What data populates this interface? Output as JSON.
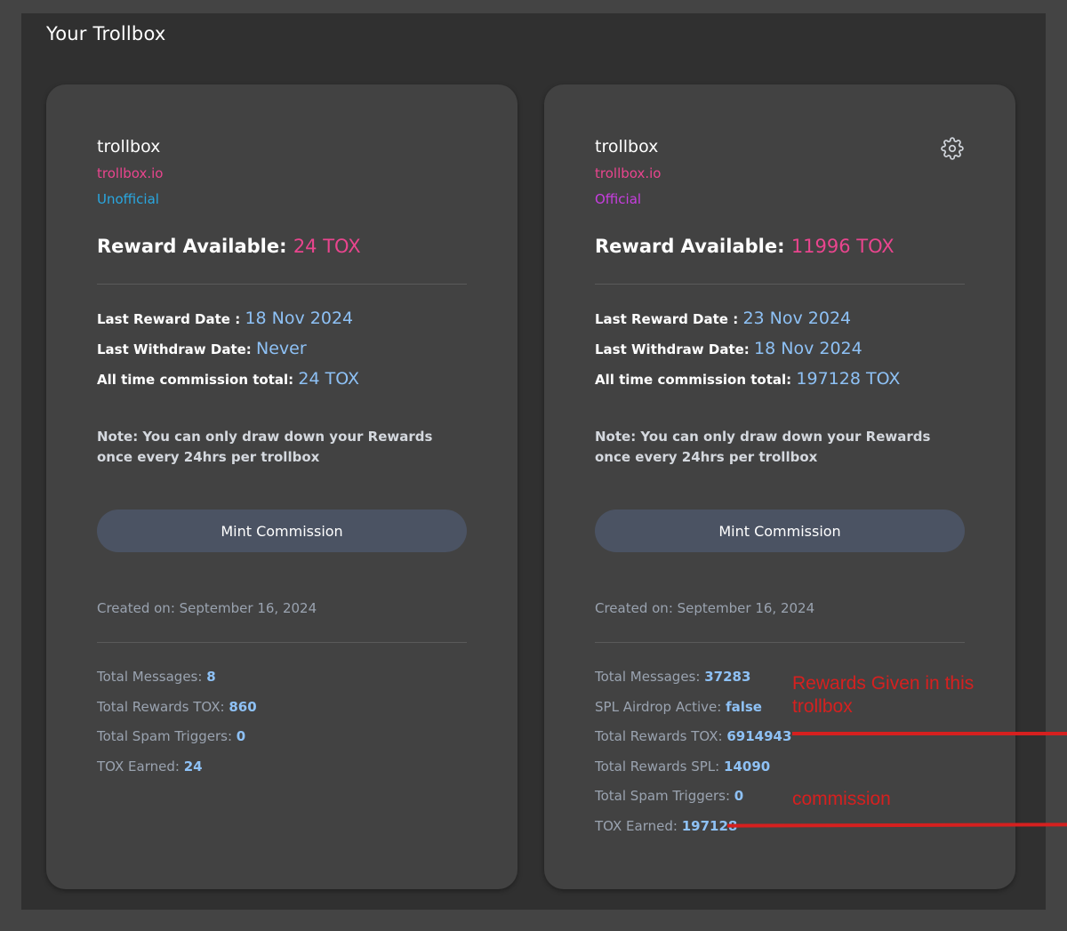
{
  "panel": {
    "title": "Your Trollbox"
  },
  "cards": [
    {
      "name": "trollbox",
      "site": "trollbox.io",
      "status": "Unofficial",
      "reward_label": "Reward Available:",
      "reward_value": "24 TOX",
      "last_reward_label": "Last Reward Date :",
      "last_reward_value": "18 Nov 2024",
      "last_withdraw_label": "Last Withdraw Date:",
      "last_withdraw_value": "Never",
      "commission_label": "All time commission total:",
      "commission_value": "24 TOX",
      "note": "Note: You can only draw down your Rewards once every 24hrs per trollbox",
      "button_label": "Mint Commission",
      "created": "Created on: September 16, 2024",
      "stats": [
        {
          "label": "Total Messages:",
          "value": "8"
        },
        {
          "label": "Total Rewards TOX:",
          "value": "860"
        },
        {
          "label": "Total Spam Triggers:",
          "value": "0"
        },
        {
          "label": "TOX Earned:",
          "value": "24"
        }
      ]
    },
    {
      "name": "trollbox",
      "site": "trollbox.io",
      "status": "Official",
      "reward_label": "Reward Available:",
      "reward_value": "11996 TOX",
      "last_reward_label": "Last Reward Date :",
      "last_reward_value": "23 Nov 2024",
      "last_withdraw_label": "Last Withdraw Date:",
      "last_withdraw_value": "18 Nov 2024",
      "commission_label": "All time commission total:",
      "commission_value": "197128 TOX",
      "note": "Note: You can only draw down your Rewards once every 24hrs per trollbox",
      "button_label": "Mint Commission",
      "created": "Created on: September 16, 2024",
      "settings_icon": "gear-icon",
      "stats": [
        {
          "label": "Total Messages:",
          "value": "37283"
        },
        {
          "label": "SPL Airdrop Active:",
          "value": "false"
        },
        {
          "label": "Total Rewards TOX:",
          "value": "6914943"
        },
        {
          "label": "Total Rewards SPL:",
          "value": "14090"
        },
        {
          "label": "Total Spam Triggers:",
          "value": "0"
        },
        {
          "label": "TOX Earned:",
          "value": "197128"
        }
      ]
    }
  ],
  "annotations": {
    "rewards_note_line1": "Rewards Given in this",
    "rewards_note_line2": "trollbox",
    "commission_note": "commission",
    "color": "#d6201f"
  },
  "colors": {
    "pink": "#e9458e",
    "blue_value": "#8ec1f5",
    "unofficial": "#29a7e0",
    "official": "#c83ee0",
    "button": "#4b5363"
  }
}
